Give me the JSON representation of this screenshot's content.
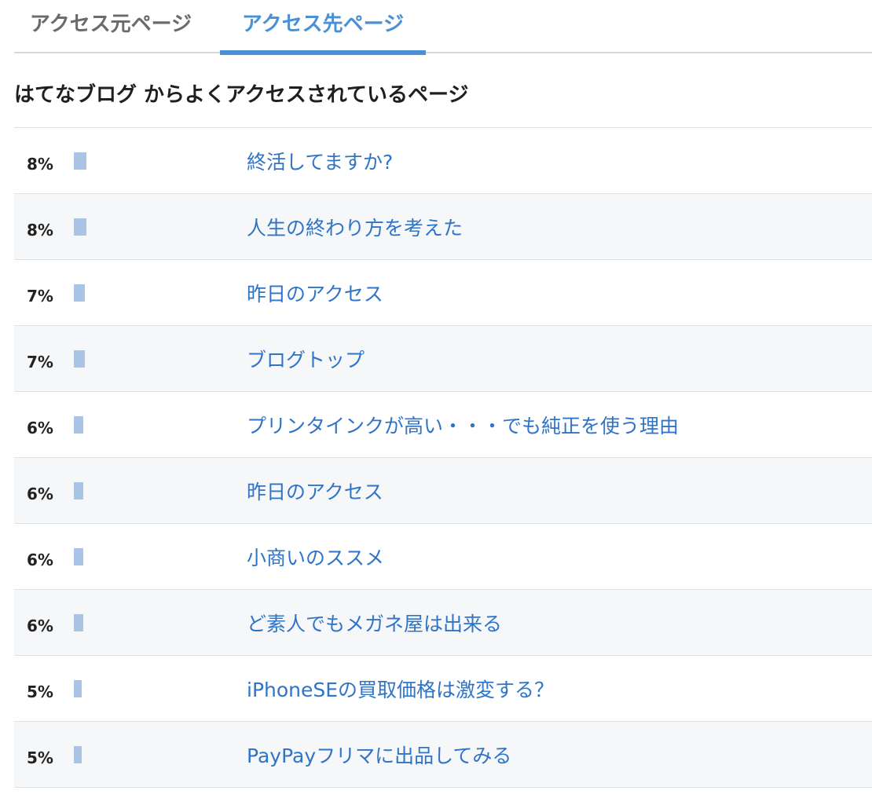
{
  "tabs": [
    {
      "label": "アクセス元ページ",
      "active": false
    },
    {
      "label": "アクセス先ページ",
      "active": true
    }
  ],
  "heading": "はてなブログ からよくアクセスされているページ",
  "colors": {
    "accent": "#4a90d6",
    "link": "#2f74c7",
    "bar": "#a9c4e4"
  },
  "rows": [
    {
      "percent_label": "8%",
      "percent": 8,
      "title": "終活してますか?"
    },
    {
      "percent_label": "8%",
      "percent": 8,
      "title": "人生の終わり方を考えた"
    },
    {
      "percent_label": "7%",
      "percent": 7,
      "title": "昨日のアクセス"
    },
    {
      "percent_label": "7%",
      "percent": 7,
      "title": "ブログトップ"
    },
    {
      "percent_label": "6%",
      "percent": 6,
      "title": "プリンタインクが高い・・・でも純正を使う理由"
    },
    {
      "percent_label": "6%",
      "percent": 6,
      "title": "昨日のアクセス"
    },
    {
      "percent_label": "6%",
      "percent": 6,
      "title": "小商いのススメ"
    },
    {
      "percent_label": "6%",
      "percent": 6,
      "title": "ど素人でもメガネ屋は出来る"
    },
    {
      "percent_label": "5%",
      "percent": 5,
      "title": "iPhoneSEの買取価格は激変する？"
    },
    {
      "percent_label": "5%",
      "percent": 5,
      "title": "PayPayフリマに出品してみる"
    }
  ]
}
